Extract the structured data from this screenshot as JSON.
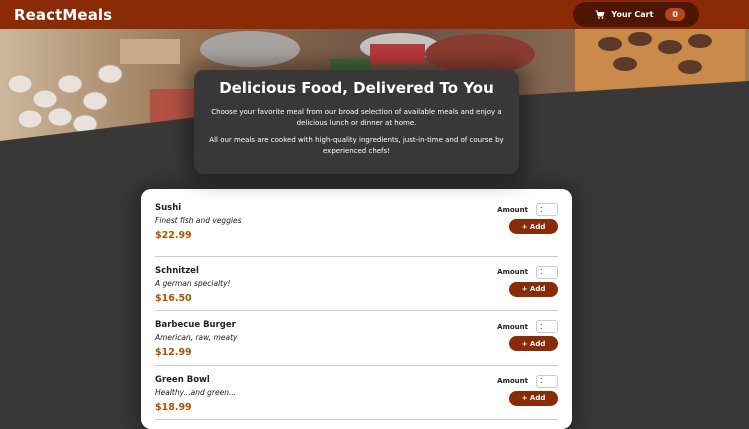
{
  "header": {
    "brand": "ReactMeals",
    "cart_label": "Your Cart",
    "cart_count": "0",
    "cart_icon": "cart-icon"
  },
  "summary": {
    "title": "Delicious Food, Delivered To You",
    "paragraph1": "Choose your favorite meal from our broad selection of available meals and enjoy a delicious lunch or dinner at home.",
    "paragraph2": "All our meals are cooked with high-quality ingredients, just-in-time and of course by experienced chefs!"
  },
  "meals": [
    {
      "name": "Sushi",
      "description": "Finest fish and veggies",
      "price": "$22.99",
      "amount_label": "Amount",
      "amount_value": "1",
      "add_label": "+ Add"
    },
    {
      "name": "Schnitzel",
      "description": "A german specialty!",
      "price": "$16.50",
      "amount_label": "Amount",
      "amount_value": "1",
      "add_label": "+ Add"
    },
    {
      "name": "Barbecue Burger",
      "description": "American, raw, meaty",
      "price": "$12.99",
      "amount_label": "Amount",
      "amount_value": "1",
      "add_label": "+ Add"
    },
    {
      "name": "Green Bowl",
      "description": "Healthy...and green...",
      "price": "$18.99",
      "amount_label": "Amount",
      "amount_value": "1",
      "add_label": "+ Add"
    }
  ],
  "colors": {
    "header_bg": "#8a2b06",
    "cart_bg": "#4d1601",
    "badge_bg": "#b94517",
    "page_bg": "#383838",
    "price": "#ad5502"
  }
}
